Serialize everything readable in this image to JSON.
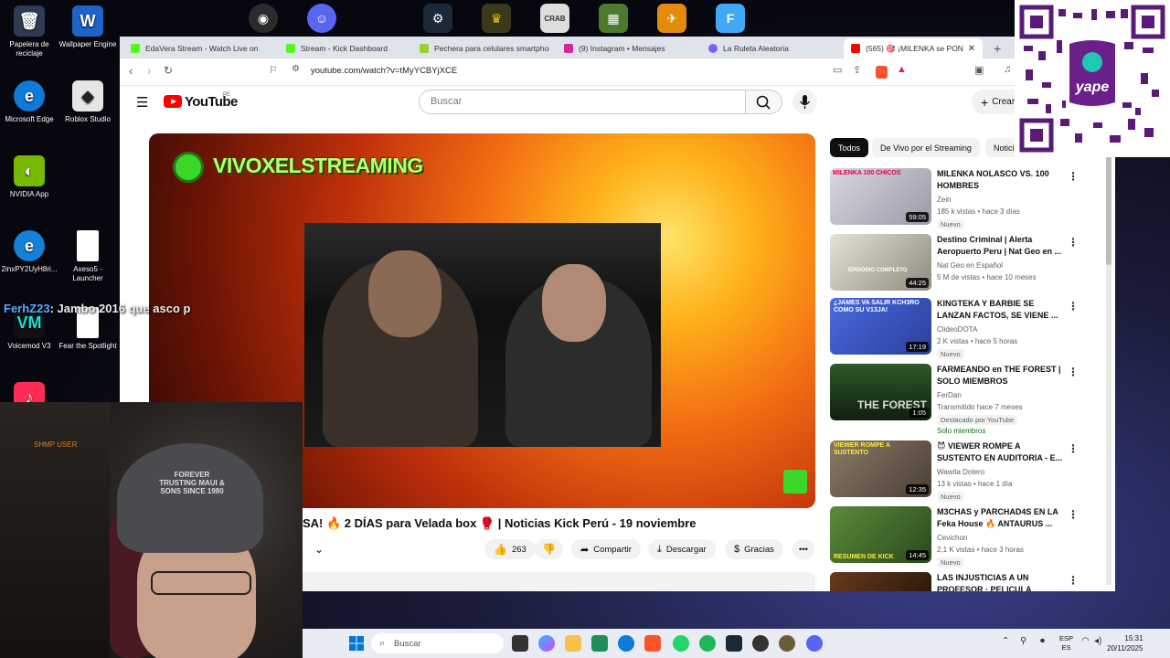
{
  "desktop": {
    "icons": [
      {
        "label": "Papelera de reciclaje"
      },
      {
        "label": "Wallpaper Engine"
      },
      {
        "label": "Microsoft Edge"
      },
      {
        "label": "Roblox Studio"
      },
      {
        "label": "NVIDIA App"
      },
      {
        "label": "2inxPY2UyH8ri..."
      },
      {
        "label": "Axeso5 - Launcher"
      },
      {
        "label": "Voicemod V3"
      },
      {
        "label": "Fear the Spotlight"
      }
    ]
  },
  "browser": {
    "tabs": [
      {
        "label": "EdaVera Stream - Watch Live on Ki",
        "color": "#53fc18"
      },
      {
        "label": "Stream - Kick Dashboard",
        "color": "#53fc18"
      },
      {
        "label": "Pechera para celulares smartphone",
        "color": "#9bd02a"
      },
      {
        "label": "(9) Instagram • Mensajes",
        "color": "#d6249f"
      },
      {
        "label": "La Ruleta Aleatoria",
        "color": "#7b61ff"
      },
      {
        "label": "(565) 🎯 ¡MILENKA se PON",
        "color": "#ff0000"
      }
    ],
    "url": "youtube.com/watch?v=tMyYCBYjXCE"
  },
  "youtube": {
    "logo_text": "YouTube",
    "region": "PE",
    "search_placeholder": "Buscar",
    "create_label": "Crear",
    "video": {
      "banner_text": "VIVOXELSTREAMING",
      "title": "SA! 🔥 2 DÍAS para Velada box 🥊 | Noticias Kick Perú - 19 noviembre",
      "likes": "263",
      "share_label": "Compartir",
      "download_label": "Descargar",
      "thanks_label": "Gracias"
    },
    "chips": [
      "Todos",
      "De Vivo por el Streaming",
      "Notici"
    ],
    "recommendations": [
      {
        "title": "MILENKA NOLASCO VS. 100 HOMBRES",
        "channel": "Zein",
        "meta": "185 k vistas • hace 3 días",
        "badge": "Nuevo",
        "duration": "59:05",
        "thumb_text": "MILENKA 100 CHICOS",
        "thumb_color": "#c9c9d2"
      },
      {
        "title": "Destino Criminal | Alerta Aeropuerto Peru | Nat Geo en ...",
        "channel": "Nat Geo en Español",
        "meta": "5 M de vistas • hace 10 meses",
        "badge": "",
        "duration": "44:25",
        "thumb_text": "EPISODIO COMPLETO",
        "thumb_color": "#b9b5ac"
      },
      {
        "title": "KINGTEKA Y BARBIE SE LANZAN FACTOS, SE VIENE ...",
        "channel": "ClideoDOTA",
        "meta": "2 K vistas • hace 5 horas",
        "badge": "Nuevo",
        "duration": "17:19",
        "thumb_text": "¿JAMES VA SALIR KCH3RO COMO SU V13JA!",
        "thumb_color": "#3a57c7"
      },
      {
        "title": "FARMEANDO en THE FOREST | SOLO MIEMBROS",
        "channel": "FerDan",
        "meta": "Transmitido hace 7 meses",
        "badge": "Destacado por YouTube",
        "extra": "Solo miembros",
        "duration": "1:05",
        "thumb_text": "THE FOREST",
        "thumb_color": "#1f3a22"
      },
      {
        "title": "😈 VIEWER ROMPE A SUSTENTO EN AUDITORIA - E...",
        "channel": "Wawita Dotero",
        "meta": "13 k vistas • hace 1 día",
        "badge": "Nuevo",
        "duration": "12:35",
        "thumb_text": "VIEWER ROMPE A SUSTENTO",
        "thumb_color": "#7a6a5a"
      },
      {
        "title": "M3CHAS y PARCHAD4S EN LA Feka House 🔥 ANTAURUS ...",
        "channel": "Cevichon",
        "meta": "2,1 K vistas • hace 3 horas",
        "badge": "Nuevo",
        "duration": "14:45",
        "thumb_text": "RESUMEN DE KICK",
        "thumb_color": "#3c6a2a"
      },
      {
        "title": "LAS INJUSTICIAS A UN PROFESOR · PELICULA",
        "channel": "",
        "meta": "",
        "badge": "",
        "duration": "",
        "thumb_text": "",
        "thumb_color": "#2a1a10"
      }
    ]
  },
  "overlay": {
    "chat_user": "FerhZ23",
    "chat_text": ": Jambo 2016 que asco p",
    "shop_user": "SHMP USER",
    "cap_text": "FOREVER TRUSTING MAUI & SONS SINCE 1980",
    "qr_brand": "yape"
  },
  "taskbar": {
    "search_label": "Buscar",
    "lang_top": "ESP",
    "lang_bottom": "ES",
    "time": "15:31",
    "date": "20/11/2025"
  }
}
